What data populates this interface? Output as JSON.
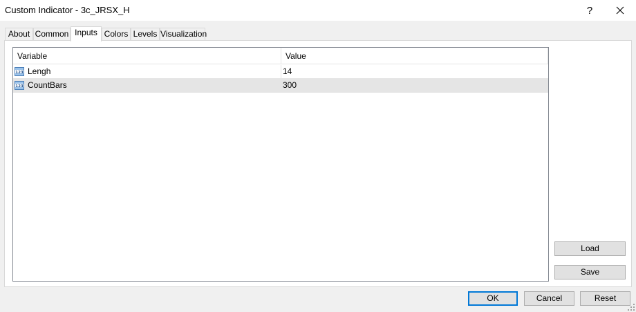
{
  "window": {
    "title": "Custom Indicator - 3c_JRSX_H",
    "help_label": "?",
    "close_icon": "close-icon"
  },
  "tabs": [
    {
      "label": "About",
      "active": false
    },
    {
      "label": "Common",
      "active": false
    },
    {
      "label": "Inputs",
      "active": true
    },
    {
      "label": "Colors",
      "active": false
    },
    {
      "label": "Levels",
      "active": false
    },
    {
      "label": "Visualization",
      "active": false
    }
  ],
  "inputs_table": {
    "columns": [
      "Variable",
      "Value"
    ],
    "rows": [
      {
        "icon": "integer-type-icon",
        "variable": "Lengh",
        "value": "14",
        "selected": false
      },
      {
        "icon": "integer-type-icon",
        "variable": "CountBars",
        "value": "300",
        "selected": true
      }
    ]
  },
  "side_buttons": {
    "load": "Load",
    "save": "Save"
  },
  "footer_buttons": {
    "ok": "OK",
    "cancel": "Cancel",
    "reset": "Reset"
  },
  "colors": {
    "accent": "#0078d7",
    "selected_row": "#e5e5e5",
    "window_bg": "#f0f0f0"
  }
}
